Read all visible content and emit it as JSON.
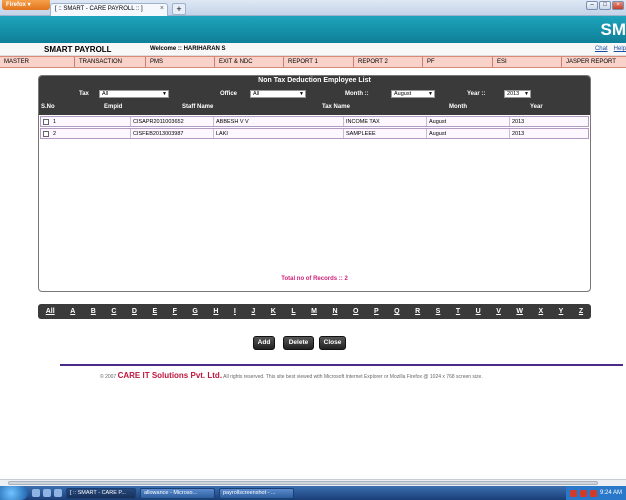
{
  "browser": {
    "firefox_label": "Firefox",
    "tab_title": "[ :: SMART - CARE PAYROLL :: ]",
    "tab_close": "×",
    "new_tab": "+",
    "win_min": "–",
    "win_max": "□",
    "win_close": "×"
  },
  "banner": {
    "logo_text": "SM"
  },
  "header": {
    "app_title": "SMART PAYROLL",
    "welcome_prefix": "Welcome :: ",
    "welcome_user": "HARIHARAN S",
    "links": [
      "Chat",
      "Help"
    ]
  },
  "menu": {
    "items": [
      "MASTER",
      "TRANSACTION",
      "PMS",
      "EXIT & NDC",
      "REPORT 1",
      "REPORT 2",
      "PF",
      "ESI",
      "JASPER REPORT"
    ]
  },
  "panel": {
    "title": "Non Tax Deduction Employee List",
    "filters": {
      "tax_label": "Tax",
      "tax_value": "All",
      "office_label": "Office",
      "office_value": "All",
      "month_label": "Month ::",
      "month_value": "August",
      "year_label": "Year ::",
      "year_value": "2013"
    },
    "columns": [
      "S.No",
      "Empid",
      "Staff Name",
      "Tax Name",
      "Month",
      "Year"
    ],
    "rows": [
      {
        "sno": "1",
        "empid": "CISAPR2011003652",
        "staff": "ABBESH V V",
        "tax": "INCOME TAX",
        "month": "August",
        "year": "2013"
      },
      {
        "sno": "2",
        "empid": "CISFEB2013003987",
        "staff": "LAKI",
        "tax": "SAMPLEEE",
        "month": "August",
        "year": "2013"
      }
    ],
    "total_label": "Total no of Records :: 2"
  },
  "alphabet": [
    "All",
    "A",
    "B",
    "C",
    "D",
    "E",
    "F",
    "G",
    "H",
    "I",
    "J",
    "K",
    "L",
    "M",
    "N",
    "O",
    "P",
    "Q",
    "R",
    "S",
    "T",
    "U",
    "V",
    "W",
    "X",
    "Y",
    "Z"
  ],
  "buttons": {
    "add": "Add",
    "delete": "Delete",
    "close": "Close"
  },
  "footer": {
    "copyright": "© 2007",
    "brand": "CARE IT Solutions Pvt. Ltd.",
    "rights": "All rights reserved.   This site best viewed with Microsoft Internet Explorer or Mozilla Firefox @ 1024 x 768 screen size."
  },
  "taskbar": {
    "tasks": [
      "[ :: SMART - CARE P...",
      "allowance - Microso...",
      "payrollscreenshot - ..."
    ],
    "clock": "9:24 AM"
  }
}
